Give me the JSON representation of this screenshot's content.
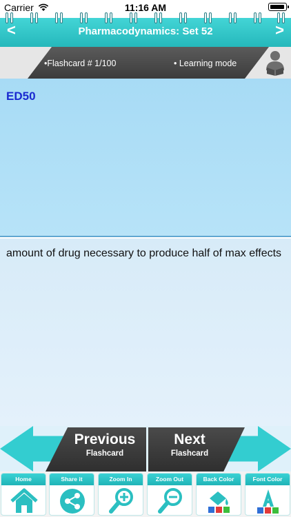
{
  "status_bar": {
    "carrier": "Carrier",
    "time": "11:16 AM"
  },
  "header": {
    "prev_symbol": "<",
    "next_symbol": ">",
    "title": "Pharmacodynamics: Set 52"
  },
  "info": {
    "flashcard_label": "•Flashcard #  1/100",
    "mode_label": "• Learning mode"
  },
  "card": {
    "question": "ED50",
    "answer": "amount of drug necessary to produce half of max effects"
  },
  "nav": {
    "previous_label": "Previous",
    "previous_sub": "Flashcard",
    "next_label": "Next",
    "next_sub": "Flashcard"
  },
  "toolbar": {
    "items": [
      {
        "label": "Home",
        "icon": "home-icon"
      },
      {
        "label": "Share it",
        "icon": "share-icon"
      },
      {
        "label": "Zoom In",
        "icon": "zoom-in-icon"
      },
      {
        "label": "Zoom Out",
        "icon": "zoom-out-icon"
      },
      {
        "label": "Back Color",
        "icon": "back-color-icon"
      },
      {
        "label": "Font Color",
        "icon": "font-color-icon"
      }
    ]
  },
  "colors": {
    "header": "#2cc6c8",
    "question_bg": "#a7dbf5",
    "answer_bg": "#dcedf9",
    "question_text": "#1a2ad0",
    "dark_button": "#3a3a3a"
  }
}
